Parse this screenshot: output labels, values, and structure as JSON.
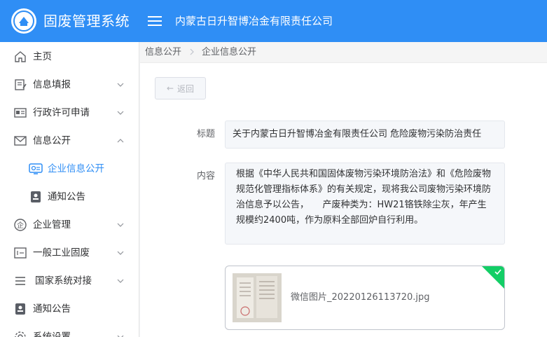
{
  "header": {
    "app_title": "固废管理系统",
    "company": "内蒙古日升智博冶金有限责任公司"
  },
  "sidebar": {
    "items": [
      {
        "label": "主页",
        "icon": "home-icon"
      },
      {
        "label": "信息填报",
        "icon": "edit-icon"
      },
      {
        "label": "行政许可申请",
        "icon": "id-card-icon"
      },
      {
        "label": "信息公开",
        "icon": "mail-icon"
      },
      {
        "label": "企业信息公开",
        "icon": "monitor-icon"
      },
      {
        "label": "通知公告",
        "icon": "notice-icon"
      },
      {
        "label": "企业管理",
        "icon": "enterprise-icon"
      },
      {
        "label": "一般工业固废",
        "icon": "waste-icon"
      },
      {
        "label": "国家系统对接",
        "icon": "list-icon"
      },
      {
        "label": "通知公告",
        "icon": "notice-icon"
      },
      {
        "label": "系统设置",
        "icon": "gear-icon"
      }
    ]
  },
  "breadcrumb": {
    "items": [
      "信息公开",
      "企业信息公开"
    ]
  },
  "main": {
    "back_label": "返回",
    "title_label": "标题",
    "title_value": "关于内蒙古日升智博冶金有限责任公司 危险废物污染防治责任",
    "content_label": "内容",
    "content_value": "根据《中华人民共和国固体废物污染环境防治法》和《危险废物规范化管理指标体系》的有关规定，现将我公司废物污染环境防治信息予以公告，　　产废种类为：HW21铬铁除尘灰，年产生规模约2400吨，作为原料全部回炉自行利用。",
    "attachment": {
      "file_name": "微信图片_20220126113720.jpg",
      "status": "uploaded"
    }
  },
  "colors": {
    "primary": "#2f8ef5",
    "success": "#13ce66"
  }
}
